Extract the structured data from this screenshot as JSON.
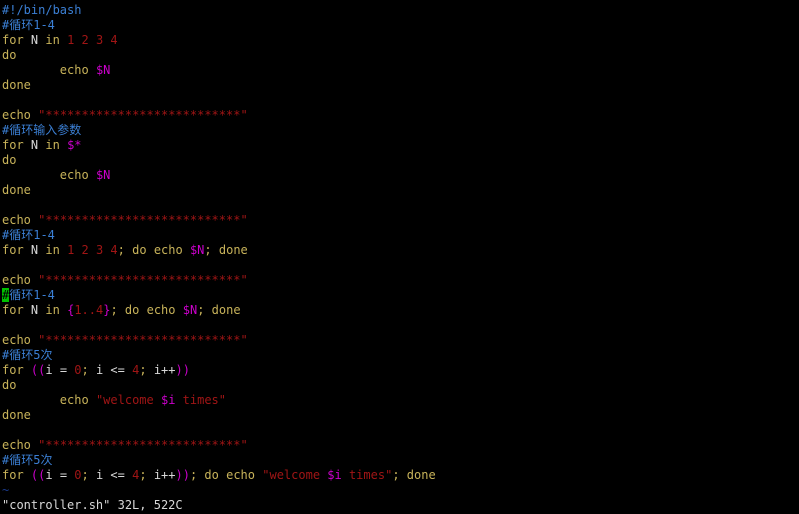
{
  "terminal": {
    "title": "vim - controller.sh",
    "background": "#000000",
    "foreground": "#c0c0c0",
    "font_size_px": 12,
    "line_height_px": 15,
    "columns": 110,
    "rows": 34
  },
  "colors": {
    "comment": "#3b7fd4",
    "keyword": "#c8b35a",
    "identifier": "#d8d8d8",
    "constant": "#a01515",
    "string": "#a01515",
    "variable": "#cc00cc",
    "brace": "#cc00cc",
    "operator": "#d8d8d8",
    "tilde": "#1a3a8a",
    "cursor_bg": "#00c000",
    "cursor_fg": "#000000"
  },
  "editor": {
    "filename": "controller.sh",
    "status_line": "\"controller.sh\" 32L, 522C",
    "line_count_label": "32L",
    "char_count_label": "522C",
    "tilde_marker": "~",
    "cursor": {
      "line_index": 19,
      "column": 0,
      "char": "#"
    }
  },
  "tokens": {
    "shebang": "#!/bin/bash",
    "comment_loop_1_4": "#循环1-4",
    "comment_loop_input_args": "#循环输入参数",
    "comment_loop_5_times": "#循环5次",
    "kw_for": "for",
    "kw_in": "in",
    "kw_do": "do",
    "kw_done": "done",
    "kw_echo": "echo",
    "var_N_name": "N",
    "var_i_name": "i",
    "var_N": "$N",
    "var_i": "$i",
    "var_star": "$*",
    "nums_1234": "1 2 3 4",
    "brace_range": "{1..4}",
    "brace_range_open": "{",
    "brace_range_body": "1..4",
    "brace_range_close": "}",
    "arith_open": "((",
    "arith_close": "))",
    "init_assign": "i = ",
    "init_value": "0",
    "cond": "i <= ",
    "cond_value": "4",
    "incr": "i++",
    "semicolon": ";",
    "quote": "\"",
    "banner_asterisks": "***************************",
    "welcome_string": "welcome $i times",
    "welcome_prefix": "welcome ",
    "welcome_suffix": " times",
    "tab_indent": "        "
  },
  "buffer_lines": [
    {
      "index": 0,
      "type": "comment",
      "text": "#!/bin/bash"
    },
    {
      "index": 1,
      "type": "comment",
      "text": "#循环1-4"
    },
    {
      "index": 2,
      "type": "code",
      "text": "for N in 1 2 3 4"
    },
    {
      "index": 3,
      "type": "code",
      "text": "do"
    },
    {
      "index": 4,
      "type": "code",
      "text": "        echo $N"
    },
    {
      "index": 5,
      "type": "code",
      "text": "done"
    },
    {
      "index": 6,
      "type": "blank",
      "text": ""
    },
    {
      "index": 7,
      "type": "code",
      "text": "echo \"***************************\""
    },
    {
      "index": 8,
      "type": "comment",
      "text": "#循环输入参数"
    },
    {
      "index": 9,
      "type": "code",
      "text": "for N in $*"
    },
    {
      "index": 10,
      "type": "code",
      "text": "do"
    },
    {
      "index": 11,
      "type": "code",
      "text": "        echo $N"
    },
    {
      "index": 12,
      "type": "code",
      "text": "done"
    },
    {
      "index": 13,
      "type": "blank",
      "text": ""
    },
    {
      "index": 14,
      "type": "code",
      "text": "echo \"***************************\""
    },
    {
      "index": 15,
      "type": "comment",
      "text": "#循环1-4"
    },
    {
      "index": 16,
      "type": "code",
      "text": "for N in 1 2 3 4; do echo $N; done"
    },
    {
      "index": 17,
      "type": "blank",
      "text": ""
    },
    {
      "index": 18,
      "type": "code",
      "text": "echo \"***************************\""
    },
    {
      "index": 19,
      "type": "comment",
      "text": "#循环1-4",
      "has_cursor": true
    },
    {
      "index": 20,
      "type": "code",
      "text": "for N in {1..4}; do echo $N; done"
    },
    {
      "index": 21,
      "type": "blank",
      "text": ""
    },
    {
      "index": 22,
      "type": "code",
      "text": "echo \"***************************\""
    },
    {
      "index": 23,
      "type": "comment",
      "text": "#循环5次"
    },
    {
      "index": 24,
      "type": "code",
      "text": "for ((i = 0; i <= 4; i++))"
    },
    {
      "index": 25,
      "type": "code",
      "text": "do"
    },
    {
      "index": 26,
      "type": "code",
      "text": "        echo \"welcome $i times\""
    },
    {
      "index": 27,
      "type": "code",
      "text": "done"
    },
    {
      "index": 28,
      "type": "blank",
      "text": ""
    },
    {
      "index": 29,
      "type": "code",
      "text": "echo \"***************************\""
    },
    {
      "index": 30,
      "type": "comment",
      "text": "#循环5次"
    },
    {
      "index": 31,
      "type": "code",
      "text": "for ((i = 0; i <= 4; i++)); do echo \"welcome $i times\"; done"
    },
    {
      "index": 32,
      "type": "tilde",
      "text": "~"
    }
  ]
}
